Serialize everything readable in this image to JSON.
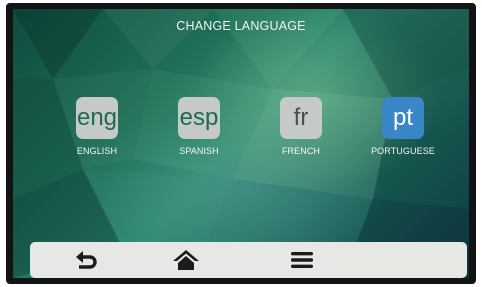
{
  "header": {
    "title": "CHANGE LANGUAGE"
  },
  "languages": [
    {
      "code": "eng",
      "label": "ENGLISH",
      "selected": false
    },
    {
      "code": "esp",
      "label": "SPANISH",
      "selected": false
    },
    {
      "code": "fr",
      "label": "FRENCH",
      "selected": false
    },
    {
      "code": "pt",
      "label": "PORTUGUESE",
      "selected": true
    }
  ],
  "nav": {
    "back_icon": "back-arrow-icon",
    "home_icon": "home-icon",
    "menu_icon": "hamburger-menu-icon"
  },
  "colors": {
    "selected_tile": "#3a87c7",
    "tile": "#c5c9c7",
    "nav_bar": "#e7e7e6"
  }
}
